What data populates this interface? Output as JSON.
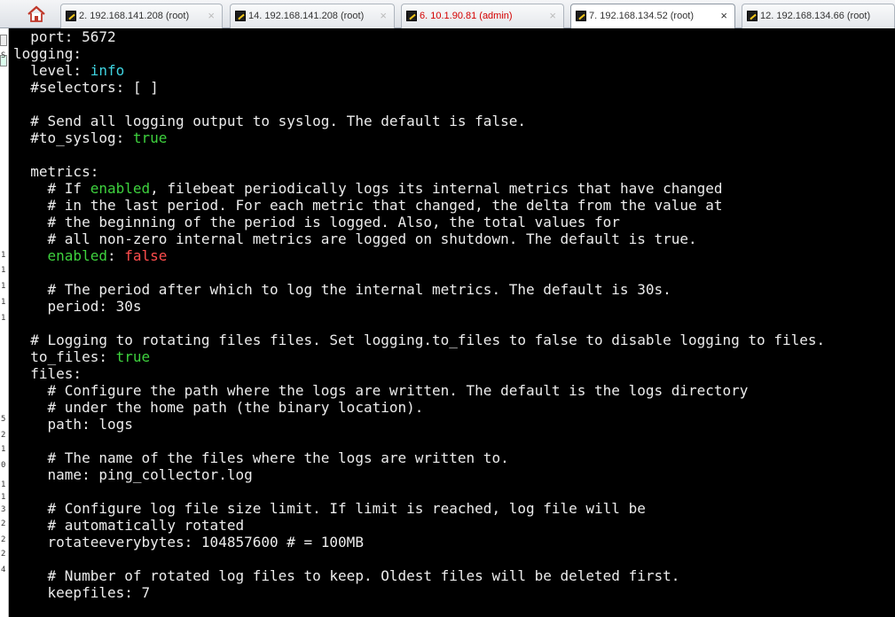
{
  "tabs": [
    {
      "label": "2. 192.168.141.208 (root)",
      "active": false,
      "color": "#333333"
    },
    {
      "label": "14. 192.168.141.208 (root)",
      "active": false,
      "color": "#333333"
    },
    {
      "label": "6. 10.1.90.81 (admin)",
      "active": false,
      "color": "#d40000"
    },
    {
      "label": "7. 192.168.134.52 (root)",
      "active": true,
      "color": "#333333"
    },
    {
      "label": "12. 192.168.134.66 (root)",
      "active": false,
      "color": "#333333"
    }
  ],
  "close_glyph": "×",
  "gutter_chars": [
    "S",
    "1",
    "1",
    "1",
    "1",
    "1",
    "5",
    "2",
    "1",
    "0",
    "1",
    "1",
    "3",
    "2",
    "2",
    "2",
    "4"
  ],
  "terminal": {
    "colors": {
      "default": "#ececec",
      "green": "#3ed23e",
      "cyan": "#3fd3e0",
      "red": "#ff4d4d"
    },
    "lines": [
      [
        {
          "t": "  port: 5672"
        }
      ],
      [
        {
          "t": "logging:"
        }
      ],
      [
        {
          "t": "  level: "
        },
        {
          "t": "info",
          "c": "cyan"
        }
      ],
      [
        {
          "t": "  #selectors: [ ]"
        }
      ],
      [
        {
          "t": ""
        }
      ],
      [
        {
          "t": "  # Send all logging output to syslog. The default is false."
        }
      ],
      [
        {
          "t": "  #to_syslog: "
        },
        {
          "t": "true",
          "c": "green"
        }
      ],
      [
        {
          "t": ""
        }
      ],
      [
        {
          "t": "  metrics:"
        }
      ],
      [
        {
          "t": "    # If "
        },
        {
          "t": "enabled",
          "c": "green"
        },
        {
          "t": ", filebeat periodically logs its internal metrics that have changed"
        }
      ],
      [
        {
          "t": "    # in the last period. For each metric that changed, the delta from the value at"
        }
      ],
      [
        {
          "t": "    # the beginning of the period is logged. Also, the total values for"
        }
      ],
      [
        {
          "t": "    # all non-zero internal metrics are logged on shutdown. The default is true."
        }
      ],
      [
        {
          "t": "    "
        },
        {
          "t": "enabled",
          "c": "green"
        },
        {
          "t": ": "
        },
        {
          "t": "false",
          "c": "red"
        }
      ],
      [
        {
          "t": ""
        }
      ],
      [
        {
          "t": "    # The period after which to log the internal metrics. The default is 30s."
        }
      ],
      [
        {
          "t": "    period: 30s"
        }
      ],
      [
        {
          "t": ""
        }
      ],
      [
        {
          "t": "  # Logging to rotating files files. Set logging.to_files to false to disable logging to files."
        }
      ],
      [
        {
          "t": "  to_files: "
        },
        {
          "t": "true",
          "c": "green"
        }
      ],
      [
        {
          "t": "  files:"
        }
      ],
      [
        {
          "t": "    # Configure the path where the logs are written. The default is the logs directory"
        }
      ],
      [
        {
          "t": "    # under the home path (the binary location)."
        }
      ],
      [
        {
          "t": "    path: logs"
        }
      ],
      [
        {
          "t": ""
        }
      ],
      [
        {
          "t": "    # The name of the files where the logs are written to."
        }
      ],
      [
        {
          "t": "    name: ping_collector.log"
        }
      ],
      [
        {
          "t": ""
        }
      ],
      [
        {
          "t": "    # Configure log file size limit. If limit is reached, log file will be"
        }
      ],
      [
        {
          "t": "    # automatically rotated"
        }
      ],
      [
        {
          "t": "    rotateeverybytes: 104857600 # = 100MB"
        }
      ],
      [
        {
          "t": ""
        }
      ],
      [
        {
          "t": "    # Number of rotated log files to keep. Oldest files will be deleted first."
        }
      ],
      [
        {
          "t": "    keepfiles: 7"
        }
      ]
    ]
  }
}
